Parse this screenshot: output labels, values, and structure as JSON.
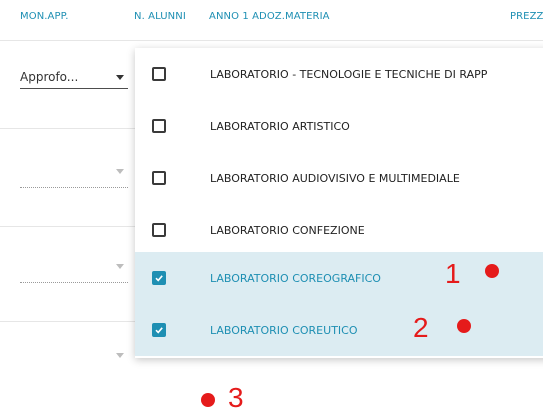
{
  "header": {
    "columns": [
      "MON.APP.",
      "N. ALUNNI",
      "ANNO 1 ADOZ.",
      "MATERIA",
      "PREZZO"
    ]
  },
  "rows": {
    "first_select_value": "Approfo..."
  },
  "dropdown": {
    "options": [
      {
        "label": "LABORATORIO - TECNOLOGIE E TECNICHE DI RAPP",
        "checked": false
      },
      {
        "label": "LABORATORIO ARTISTICO",
        "checked": false
      },
      {
        "label": "LABORATORIO AUDIOVISIVO E MULTIMEDIALE",
        "checked": false
      },
      {
        "label": "LABORATORIO CONFEZIONE",
        "checked": false
      },
      {
        "label": "LABORATORIO COREOGRAFICO",
        "checked": true
      },
      {
        "label": "LABORATORIO COREUTICO",
        "checked": true
      }
    ]
  },
  "annotations": {
    "label_1": "1",
    "label_2": "2",
    "label_3": "3"
  },
  "colors": {
    "accent": "#1e8fb3",
    "selected_bg": "#dcecf2",
    "annotation": "#e51b1b"
  }
}
